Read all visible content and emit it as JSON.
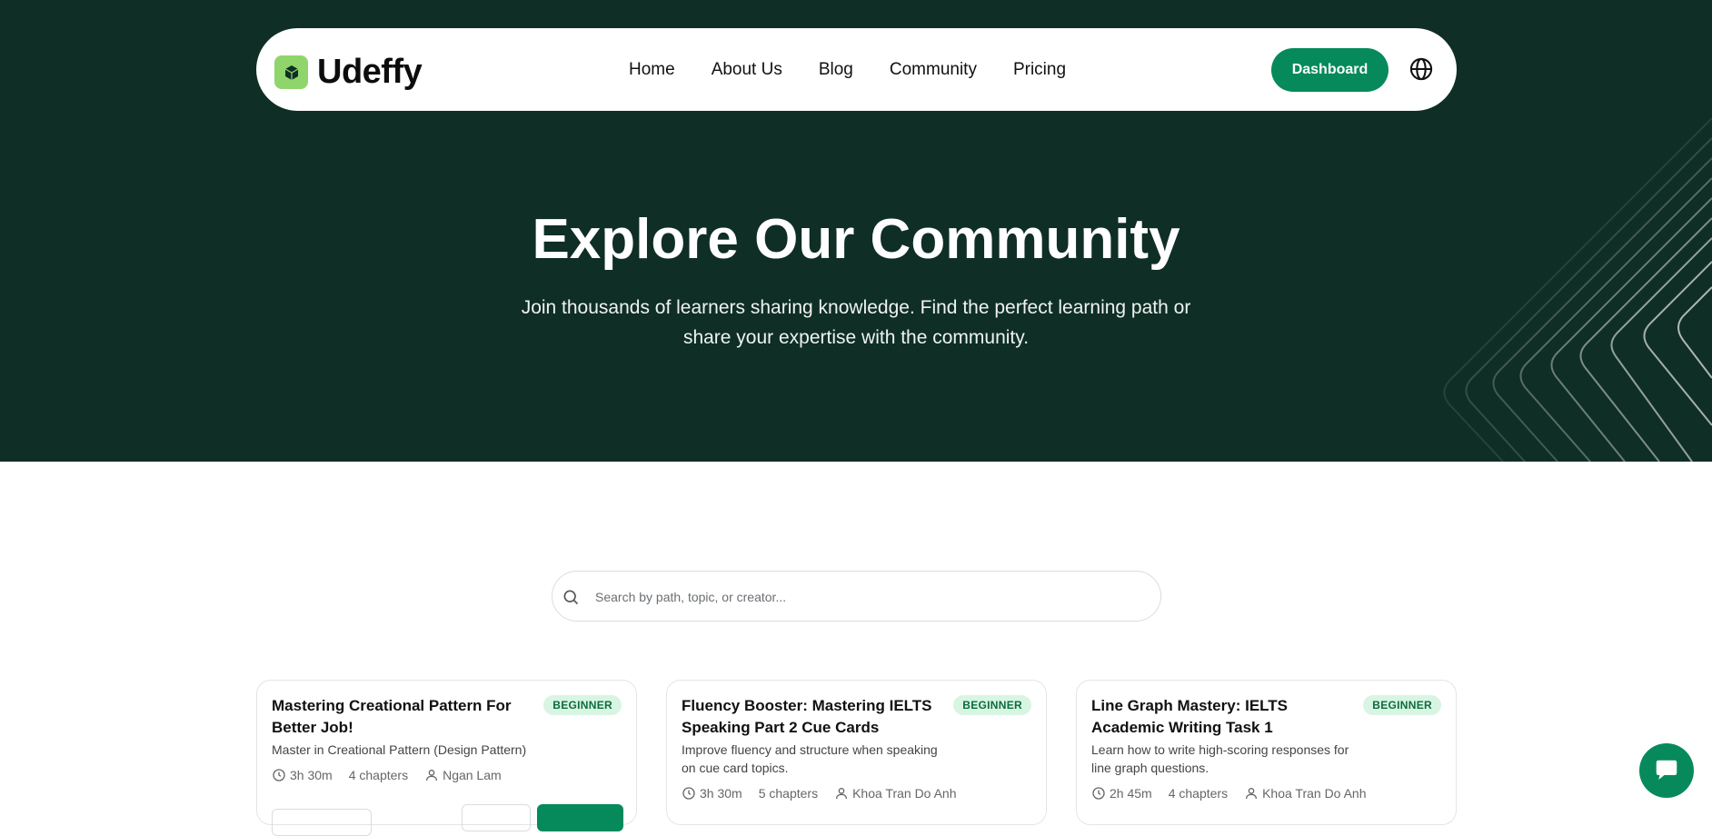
{
  "brand": {
    "name": "Udeffy"
  },
  "nav": {
    "links": [
      {
        "label": "Home"
      },
      {
        "label": "About Us"
      },
      {
        "label": "Blog"
      },
      {
        "label": "Community"
      },
      {
        "label": "Pricing"
      }
    ],
    "dashboard_label": "Dashboard",
    "language_icon": "globe-icon"
  },
  "hero": {
    "title": "Explore Our Community",
    "subtitle": "Join thousands of learners sharing knowledge. Find the perfect learning path or share your expertise with the community."
  },
  "search": {
    "placeholder": "Search by path, topic, or creator...",
    "value": ""
  },
  "cards": [
    {
      "title": "Mastering Creational Pattern For Better Job!",
      "level": "BEGINNER",
      "description": "Master in Creational Pattern (Design Pattern)",
      "duration": "3h 30m",
      "chapters": "4 chapters",
      "author": "Ngan Lam"
    },
    {
      "title": "Fluency Booster: Mastering IELTS Speaking Part 2 Cue Cards",
      "level": "BEGINNER",
      "description": "Improve fluency and structure when speaking on cue card topics.",
      "duration": "3h 30m",
      "chapters": "5 chapters",
      "author": "Khoa Tran Do Anh"
    },
    {
      "title": "Line Graph Mastery: IELTS Academic Writing Task 1",
      "level": "BEGINNER",
      "description": "Learn how to write high-scoring responses for line graph questions.",
      "duration": "2h 45m",
      "chapters": "4 chapters",
      "author": "Khoa Tran Do Anh"
    }
  ],
  "colors": {
    "hero_bg": "#0f2e25",
    "accent": "#068a5c",
    "logo": "#8fd56b",
    "badge_bg": "#d8f5e3",
    "badge_text": "#0d6b3e"
  },
  "chat": {
    "icon": "chat-bubble-icon"
  }
}
